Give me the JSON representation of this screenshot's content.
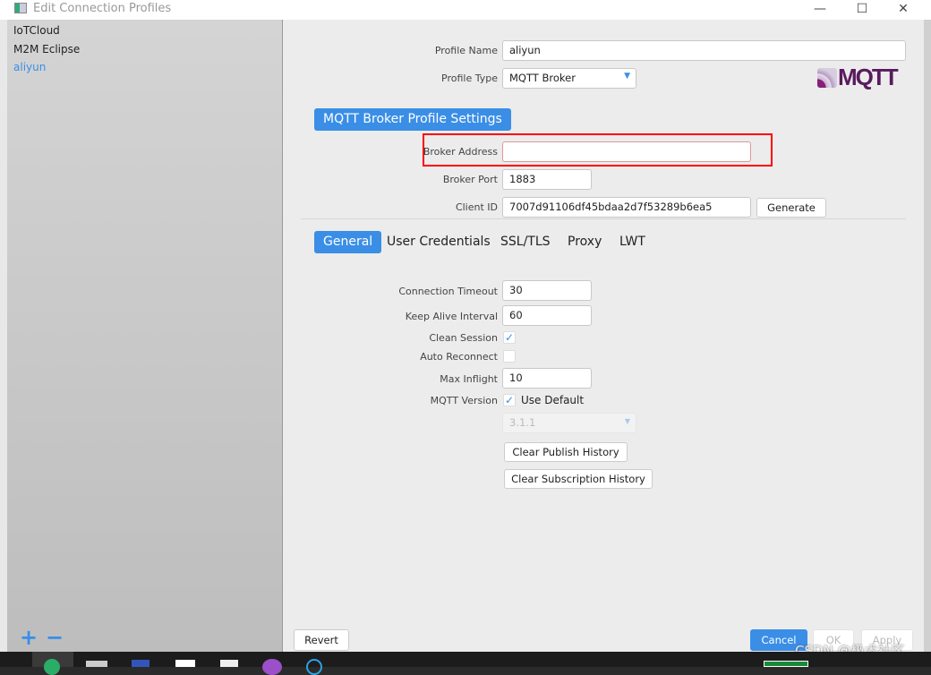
{
  "window": {
    "title": "Edit Connection Profiles",
    "minimize": "—",
    "maximize": "☐",
    "close": "✕"
  },
  "sidebar": {
    "profiles": [
      {
        "label": "IoTCloud",
        "selected": false
      },
      {
        "label": "M2M Eclipse",
        "selected": false
      },
      {
        "label": "aliyun",
        "selected": true
      }
    ],
    "add": "+",
    "remove": "−"
  },
  "form": {
    "profile_name_label": "Profile Name",
    "profile_name": "aliyun",
    "profile_type_label": "Profile Type",
    "profile_type": "MQTT Broker",
    "logo": "MQTT .org",
    "section_title": "MQTT Broker Profile Settings",
    "broker_address_label": "Broker Address",
    "broker_address": "",
    "broker_port_label": "Broker Port",
    "broker_port": "1883",
    "client_id_label": "Client ID",
    "client_id": "7007d91106df45bdaa2d7f53289b6ea5",
    "generate": "Generate"
  },
  "tabs": [
    {
      "label": "General",
      "active": true
    },
    {
      "label": "User Credentials"
    },
    {
      "label": "SSL/TLS"
    },
    {
      "label": "Proxy"
    },
    {
      "label": "LWT"
    }
  ],
  "general": {
    "connection_timeout_label": "Connection Timeout",
    "connection_timeout": "30",
    "keep_alive_label": "Keep Alive Interval",
    "keep_alive": "60",
    "clean_session_label": "Clean Session",
    "clean_session": true,
    "auto_reconnect_label": "Auto Reconnect",
    "auto_reconnect": false,
    "max_inflight_label": "Max Inflight",
    "max_inflight": "10",
    "mqtt_version_label": "MQTT Version",
    "use_default_label": "Use Default",
    "use_default": true,
    "mqtt_version": "3.1.1",
    "clear_publish": "Clear Publish History",
    "clear_subscription": "Clear Subscription History"
  },
  "footer": {
    "revert": "Revert",
    "cancel": "Cancel",
    "ok": "OK",
    "apply": "Apply"
  },
  "watermark": "CSDN @极术社区",
  "colors": {
    "accent": "#3a8ee6",
    "highlight": "#ff0000"
  }
}
